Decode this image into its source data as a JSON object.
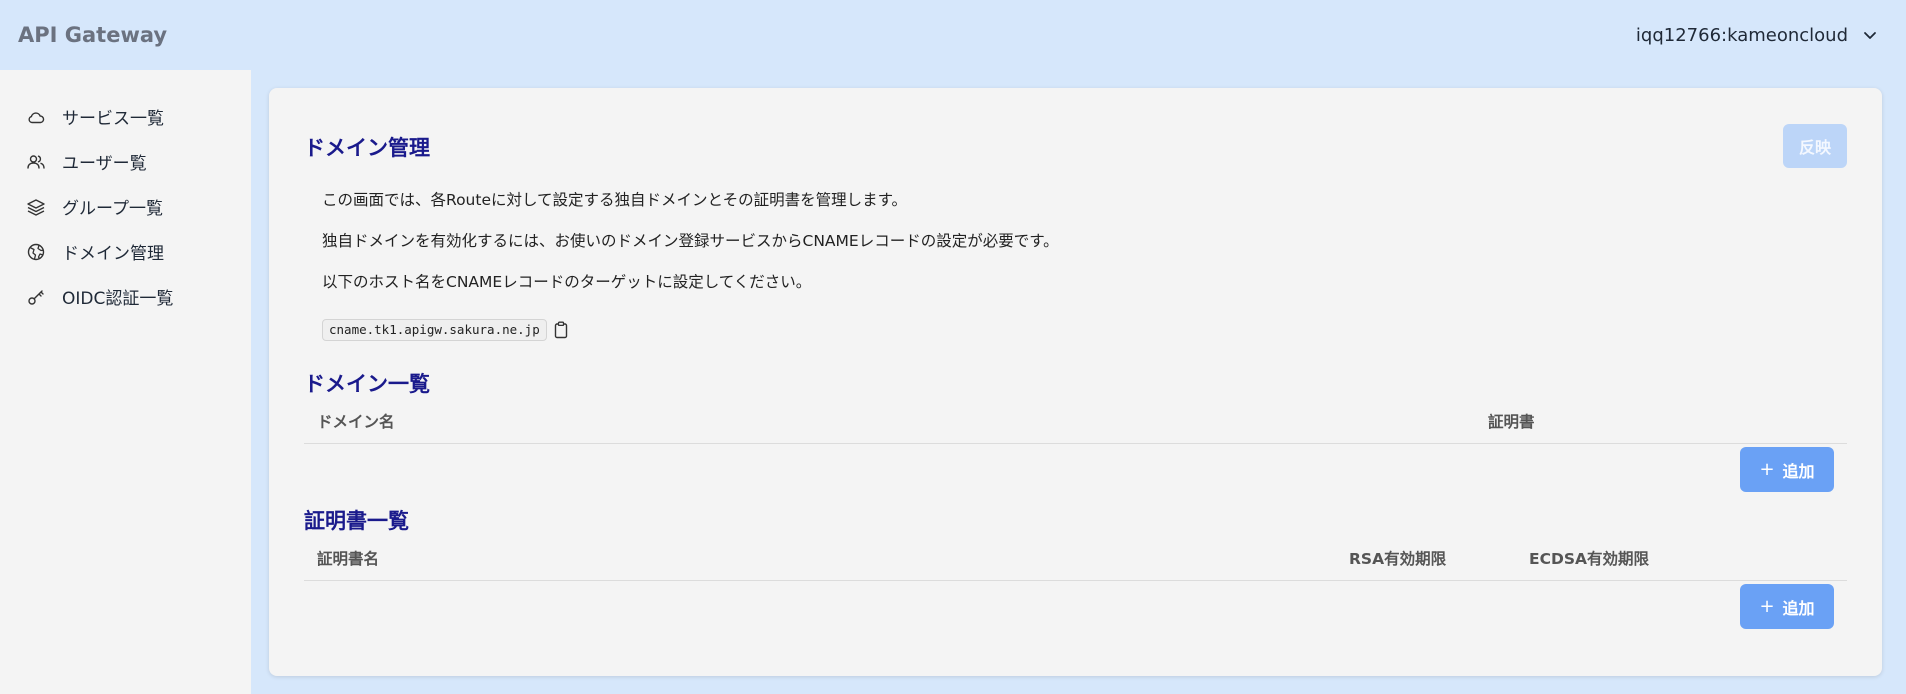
{
  "header": {
    "app_title": "API Gateway",
    "account": "iqq12766:kameoncloud"
  },
  "sidebar": {
    "items": [
      {
        "label": "サービス一覧",
        "icon": "cloud-icon"
      },
      {
        "label": "ユーザー覧",
        "icon": "users-icon"
      },
      {
        "label": "グループ一覧",
        "icon": "layers-icon"
      },
      {
        "label": "ドメイン管理",
        "icon": "globe-icon"
      },
      {
        "label": "OIDC認証一覧",
        "icon": "key-icon"
      }
    ]
  },
  "main": {
    "title": "ドメイン管理",
    "apply_label": "反映",
    "descriptions": [
      "この画面では、各Routeに対して設定する独自ドメインとその証明書を管理します。",
      "独自ドメインを有効化するには、お使いのドメイン登録サービスからCNAMEレコードの設定が必要です。",
      "以下のホスト名をCNAMEレコードのターゲットに設定してください。"
    ],
    "cname_host": "cname.tk1.apigw.sakura.ne.jp",
    "domains": {
      "title": "ドメイン一覧",
      "columns": [
        "ドメイン名",
        "証明書"
      ],
      "add_label": "追加"
    },
    "certificates": {
      "title": "証明書一覧",
      "columns": [
        "証明書名",
        "RSA有効期限",
        "ECDSA有効期限"
      ],
      "add_label": "追加"
    }
  },
  "colors": {
    "background": "#d6e7fb",
    "heading": "#1a1a8c",
    "primary_button": "#6aa1f5",
    "disabled_button": "#bcd5f8"
  }
}
